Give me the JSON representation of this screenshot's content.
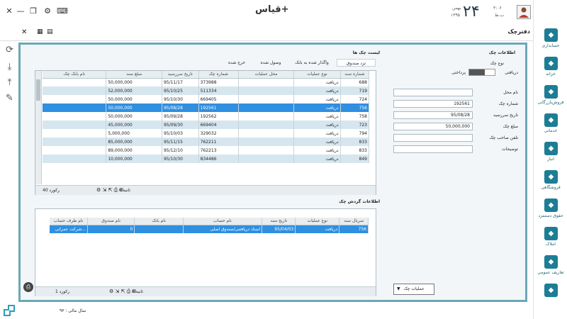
{
  "app": {
    "brand": "قیاس+",
    "page_title": "دفترچک",
    "status_fiscal_year": "سال مالی : ۹۳"
  },
  "clock": {
    "day": "۲۴",
    "month": "بهمن",
    "year": "۱۳۹۵",
    "time": "۴:۰۶",
    "ampm": "ب.ظ"
  },
  "window": {
    "close": "✕",
    "minimize": "—",
    "restore": "❐",
    "settings": "⚙",
    "keyboard": "⌨"
  },
  "nav": [
    {
      "label": "حسابداری",
      "icon": "book-icon",
      "color": "#1d7d95"
    },
    {
      "label": "خزانه",
      "icon": "vault-icon",
      "color": "#1d7d95"
    },
    {
      "label": "فروش‌بازرگانی",
      "icon": "globe-icon",
      "color": "#1d7d95"
    },
    {
      "label": "خدماتی",
      "icon": "gear-icon",
      "color": "#1d7d95"
    },
    {
      "label": "انبار",
      "icon": "warehouse-icon",
      "color": "#1d7d95"
    },
    {
      "label": "فروشگاهی",
      "icon": "shop-icon",
      "color": "#1d7d95"
    },
    {
      "label": "حقوق دستمزد",
      "icon": "wage-icon",
      "color": "#1d7d95"
    },
    {
      "label": "املاک",
      "icon": "house-icon",
      "color": "#1d7d95"
    },
    {
      "label": "تعاریف عمومی",
      "icon": "list-icon",
      "color": "#1d7d95"
    },
    {
      "label": "",
      "icon": "chart-icon",
      "color": "#1d7d95"
    }
  ],
  "form": {
    "section_title": "اطلاعات چک",
    "type_label": "نوع چک",
    "toggle_pay": "پرداختی",
    "toggle_recv": "دریافتی",
    "fields": [
      {
        "label": "نام محل",
        "value": ""
      },
      {
        "label": "شماره چک",
        "value": "192561"
      },
      {
        "label": "تاریخ سررسید",
        "value": "95/08/28"
      },
      {
        "label": "مبلغ چک",
        "value": "50,000,000"
      },
      {
        "label": "تلفن صاحب چک",
        "value": ""
      },
      {
        "label": "توضیحات",
        "value": ""
      }
    ],
    "ops_button": "عملیات چک"
  },
  "checks": {
    "title": "لیست چک ها",
    "tabs": [
      "نزد صندوق",
      "واگذار شده به بانک",
      "وصول شده",
      "خرج شده"
    ],
    "columns": [
      "شماره سند",
      "نوع عملیات",
      "محل عملیات",
      "شماره چک",
      "تاریخ سررسید",
      "مبلغ سند",
      "نام بانک چک"
    ],
    "rows": [
      [
        "688",
        "دریافت",
        "",
        "373988",
        "95/11/17",
        "50,000,000",
        ""
      ],
      [
        "719",
        "دریافت",
        "",
        "511334",
        "95/10/25",
        "52,000,000",
        ""
      ],
      [
        "724",
        "دریافت",
        "",
        "669405",
        "95/10/30",
        "50,000,000",
        ""
      ],
      [
        "756",
        "دریافت",
        "",
        "192561",
        "95/08/28",
        "50,000,000",
        ""
      ],
      [
        "758",
        "دریافت",
        "",
        "192562",
        "95/09/28",
        "50,000,000",
        ""
      ],
      [
        "723",
        "دریافت",
        "",
        "669404",
        "95/09/30",
        "45,000,000",
        ""
      ],
      [
        "794",
        "دریافت",
        "",
        "329032",
        "95/10/03",
        "5,000,000",
        ""
      ],
      [
        "833",
        "دریافت",
        "",
        "762211",
        "95/11/15",
        "85,000,000",
        ""
      ],
      [
        "833",
        "دریافت",
        "",
        "762213",
        "95/12/10",
        "89,000,000",
        ""
      ],
      [
        "849",
        "دریافت",
        "",
        "834486",
        "95/10/30",
        "10,000,000",
        ""
      ]
    ],
    "selected_index": 3,
    "footer_count": "40 رکورد",
    "footer_pages": "0 ثانیه"
  },
  "history": {
    "title": "اطلاعات گردش چک",
    "columns": [
      "سریال سند",
      "نوع عملیات",
      "تاریخ سند",
      "نام حساب",
      "نام بانک",
      "نام صندوق",
      "نام طرف حساب"
    ],
    "rows": [
      [
        "756",
        "دریافت",
        "95/04/03",
        "اسناد دریافتنی/صندوق اصلی",
        "",
        "0",
        "شرکت عمرانی..."
      ]
    ],
    "footer_count": "1 رکورد",
    "footer_pages": "0 ثانیه"
  }
}
